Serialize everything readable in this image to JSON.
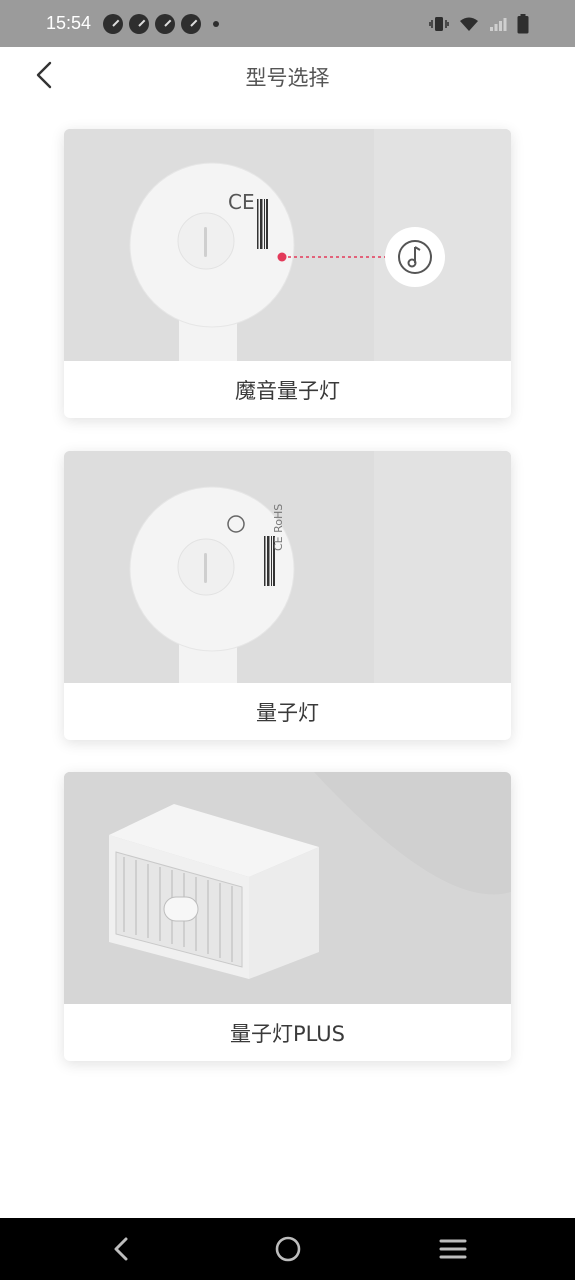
{
  "status_bar": {
    "time": "15:54",
    "icons": [
      "notification-icon",
      "notification-icon",
      "notification-icon",
      "notification-icon",
      "more-dot-icon",
      "vibrate-icon",
      "wifi-icon",
      "signal-icon",
      "battery-icon"
    ]
  },
  "header": {
    "title": "型号选择",
    "back_icon": "chevron-left-icon"
  },
  "cards": [
    {
      "label": "魔音量子灯",
      "image": "round-light-back-with-music-icon"
    },
    {
      "label": "量子灯",
      "image": "round-light-back"
    },
    {
      "label": "量子灯PLUS",
      "image": "box-device"
    }
  ],
  "navbar": {
    "icons": [
      "nav-back-icon",
      "nav-home-icon",
      "nav-menu-icon"
    ]
  },
  "colors": {
    "status_bar_bg": "#9b9b9b",
    "card_image_bg": "#dcdcdc",
    "accent_red": "#e33a5a",
    "navbar_bg": "#000000"
  }
}
